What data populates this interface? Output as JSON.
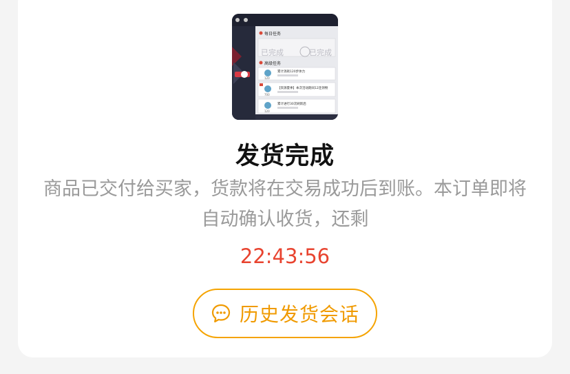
{
  "status": {
    "title": "发货完成",
    "description": "商品已交付给买家，货款将在交易成功后到账。本订单即将自动确认收货，还剩",
    "countdown": "22:43:56"
  },
  "thumbnail": {
    "section_a": "每日任务",
    "section_b": "高级任务",
    "stamp_text": "已完成",
    "task_1": "累计消耗120步体力",
    "task_2": "【资源夏季】本次活动期间12连领物",
    "task_3": "累计进行30次刷新后",
    "badge_1": "120",
    "badge_2": "700",
    "badge_3": "120"
  },
  "actions": {
    "history_button_label": "历史发货会话",
    "history_icon": "chat-bubble-icon"
  },
  "colors": {
    "accent": "#f5a300",
    "countdown": "#e8432f",
    "muted_text": "#9a9a9a"
  }
}
